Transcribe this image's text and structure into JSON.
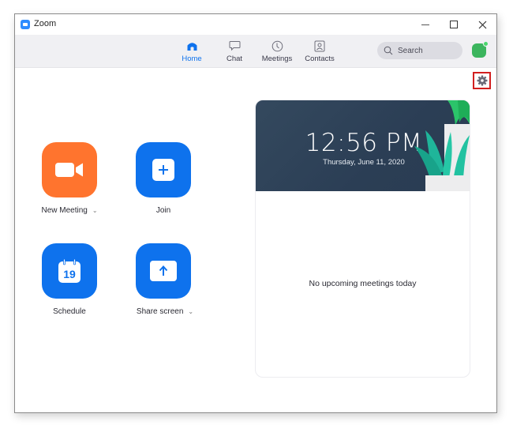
{
  "window": {
    "title": "Zoom",
    "controls": {
      "minimize": "minimize",
      "maximize": "maximize",
      "close": "close"
    }
  },
  "nav": {
    "tabs": [
      {
        "label": "Home",
        "icon": "home-icon",
        "active": true
      },
      {
        "label": "Chat",
        "icon": "chat-bubble-icon",
        "active": false
      },
      {
        "label": "Meetings",
        "icon": "clock-icon",
        "active": false
      },
      {
        "label": "Contacts",
        "icon": "contact-card-icon",
        "active": false
      }
    ],
    "search": {
      "placeholder": "Search",
      "value": ""
    },
    "avatar": {
      "status": "online"
    }
  },
  "settings": {
    "label": "Settings",
    "icon": "gear-icon",
    "highlighted": true
  },
  "actions": [
    {
      "label": "New Meeting",
      "icon": "video-camera-icon",
      "has_dropdown": true,
      "color": "#ff742e"
    },
    {
      "label": "Join",
      "icon": "plus-icon",
      "has_dropdown": false,
      "color": "#0e72ed"
    },
    {
      "label": "Schedule",
      "icon": "calendar-icon",
      "calendar_day": "19",
      "has_dropdown": false,
      "color": "#0e72ed"
    },
    {
      "label": "Share screen",
      "icon": "share-up-arrow-icon",
      "has_dropdown": true,
      "color": "#0e72ed"
    }
  ],
  "caret_glyph": "⌄",
  "meetings_panel": {
    "time": "12:56 PM",
    "date": "Thursday, June 11, 2020",
    "empty_message": "No upcoming meetings today"
  },
  "colors": {
    "accent_blue": "#0e72ed",
    "accent_orange": "#ff742e",
    "header_navy": "#2f435a",
    "avatar_green": "#3cb55e",
    "highlight_red": "#d21f1f"
  }
}
